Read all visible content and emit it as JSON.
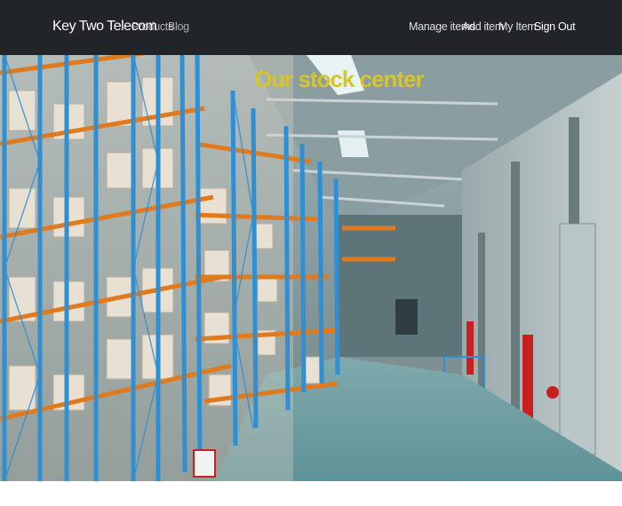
{
  "navbar": {
    "brand": "Key Two Telecom",
    "left_links": [
      "Products",
      "Blog"
    ],
    "right_links": [
      "Manage items",
      "Add item",
      "My Item",
      "Sign Out"
    ]
  },
  "hero": {
    "title": "Our stock center",
    "image": "warehouse-interior-photo"
  },
  "colors": {
    "navbar_bg": "#212529",
    "hero_title": "#d6c52a",
    "rack_blue": "#2f8fd4",
    "rack_orange": "#e07a1f"
  }
}
